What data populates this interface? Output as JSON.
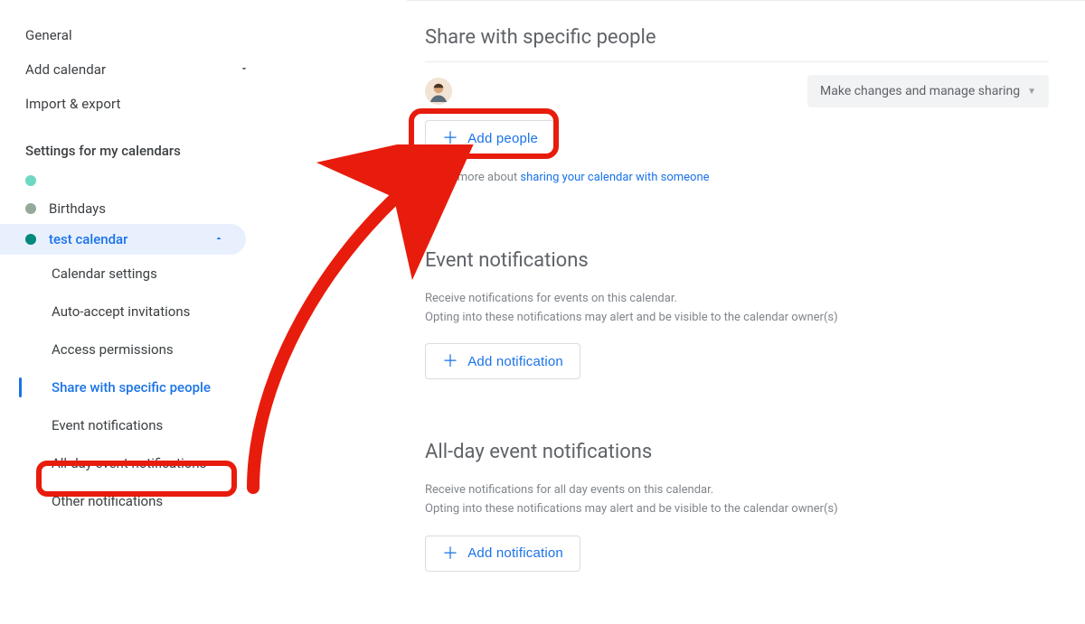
{
  "sidebar": {
    "general": "General",
    "add_calendar": "Add calendar",
    "import_export": "Import & export",
    "section_header": "Settings for my calendars",
    "calendars": [
      {
        "name": "",
        "color": "#6fd8c3"
      },
      {
        "name": "Birthdays",
        "color": "#95a99a"
      },
      {
        "name": "test calendar",
        "color": "#00897b"
      }
    ],
    "sub_items": [
      "Calendar settings",
      "Auto-accept invitations",
      "Access permissions",
      "Share with specific people",
      "Event notifications",
      "All-day event notifications",
      "Other notifications"
    ]
  },
  "share": {
    "title": "Share with specific people",
    "permission": "Make changes and manage sharing",
    "add_people": "Add people",
    "learn_prefix": "Learn more about ",
    "learn_link": "sharing your calendar with someone"
  },
  "event_notif": {
    "title": "Event notifications",
    "desc_line1": "Receive notifications for events on this calendar.",
    "desc_line2": "Opting into these notifications may alert and be visible to the calendar owner(s)",
    "add": "Add notification"
  },
  "allday_notif": {
    "title": "All-day event notifications",
    "desc_line1": "Receive notifications for all day events on this calendar.",
    "desc_line2": "Opting into these notifications may alert and be visible to the calendar owner(s)",
    "add": "Add notification"
  }
}
